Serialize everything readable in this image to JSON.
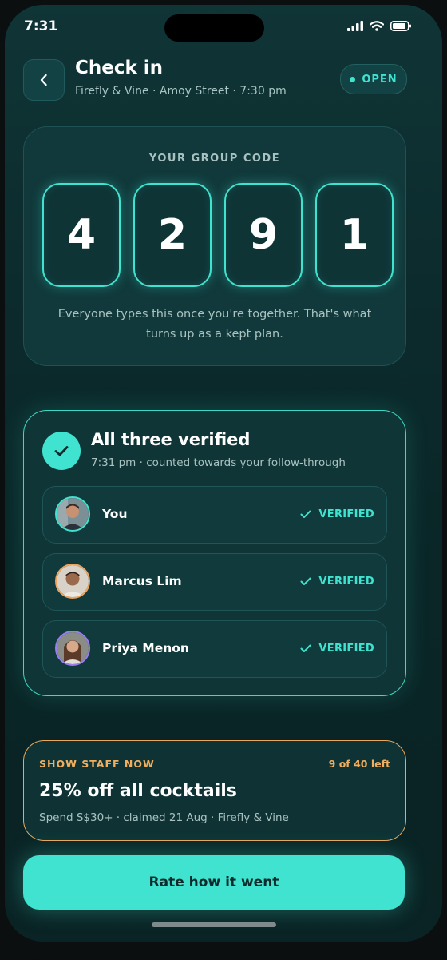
{
  "status_bar": {
    "time": "7:31"
  },
  "header": {
    "title": "Check in",
    "subtitle": "Firefly & Vine · Amoy Street · 7:30 pm",
    "status_pill": "OPEN"
  },
  "group_code": {
    "label": "YOUR GROUP CODE",
    "digits": [
      "4",
      "2",
      "9",
      "1"
    ],
    "note": "Everyone types this once you're together. That's what turns up as a kept plan."
  },
  "verification": {
    "title": "All three verified",
    "subtitle": "7:31 pm · counted towards your follow-through",
    "members": [
      {
        "name": "You",
        "status": "VERIFIED"
      },
      {
        "name": "Marcus Lim",
        "status": "VERIFIED"
      },
      {
        "name": "Priya Menon",
        "status": "VERIFIED"
      }
    ]
  },
  "offer": {
    "tag": "SHOW STAFF NOW",
    "remaining": "9 of 40 left",
    "title": "25% off all cocktails",
    "meta": "Spend S$30+ · claimed 21 Aug · Firefly & Vine"
  },
  "cta": {
    "label": "Rate how it went"
  },
  "colors": {
    "accent": "#3fe3cf",
    "offer_accent": "#f1ae5e",
    "background": "#0c2b2d"
  }
}
